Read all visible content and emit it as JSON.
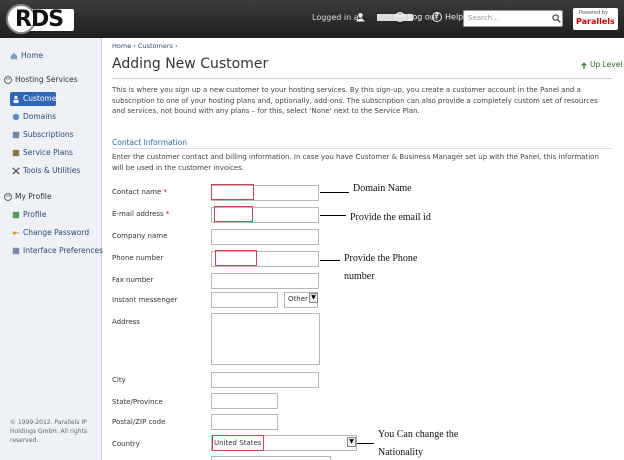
{
  "header": {
    "logo_text": "RDS",
    "logged_in_prefix": "Logged in as",
    "logout_label": "Log out",
    "help_label": "Help",
    "search_placeholder": "Search...",
    "powered_by": "Powered by",
    "brand": "Parallels"
  },
  "sidebar": {
    "home": "Home",
    "hosting_services": "Hosting Services",
    "customers": "Customers",
    "domains": "Domains",
    "subscriptions": "Subscriptions",
    "service_plans": "Service Plans",
    "tools": "Tools & Utilities",
    "my_profile": "My Profile",
    "profile": "Profile",
    "change_password": "Change Password",
    "interface_prefs": "Interface Preferences",
    "copyright": "© 1999-2012. Parallels IP Holdings GmbH. All rights reserved."
  },
  "main": {
    "breadcrumb": "Home › Customers ›",
    "title": "Adding New Customer",
    "up_level": "Up Level",
    "intro": "This is where you sign up a new customer to your hosting services. By this sign-up, you create a customer account in the Panel and a subscription to one of your hosting plans and, optionally, add-ons. The subscription can also provide a completely custom set of resources and services, not bound with any plans – for this, select 'None' next to the Service Plan.",
    "section_title": "Contact Information",
    "section_desc": "Enter the customer contact and billing information. In case you have Customer & Business Manager set up with the Panel, this information will be used in the customer invoices."
  },
  "form": {
    "contact_name": "Contact name",
    "email": "E-mail address",
    "company": "Company name",
    "phone": "Phone number",
    "fax": "Fax number",
    "im": "Instant messenger",
    "im_type": "Other",
    "address": "Address",
    "city": "City",
    "state": "State/Province",
    "zip": "Postal/ZIP code",
    "country": "Country",
    "country_value": "United States",
    "required_mark": "*"
  },
  "annotations": {
    "domain_name": "Domain Name",
    "email_id": "Provide the email id",
    "phone_line1": "Provide the Phone",
    "phone_line2": "number",
    "nationality_line1": "You Can change the",
    "nationality_line2": "Nationality"
  }
}
